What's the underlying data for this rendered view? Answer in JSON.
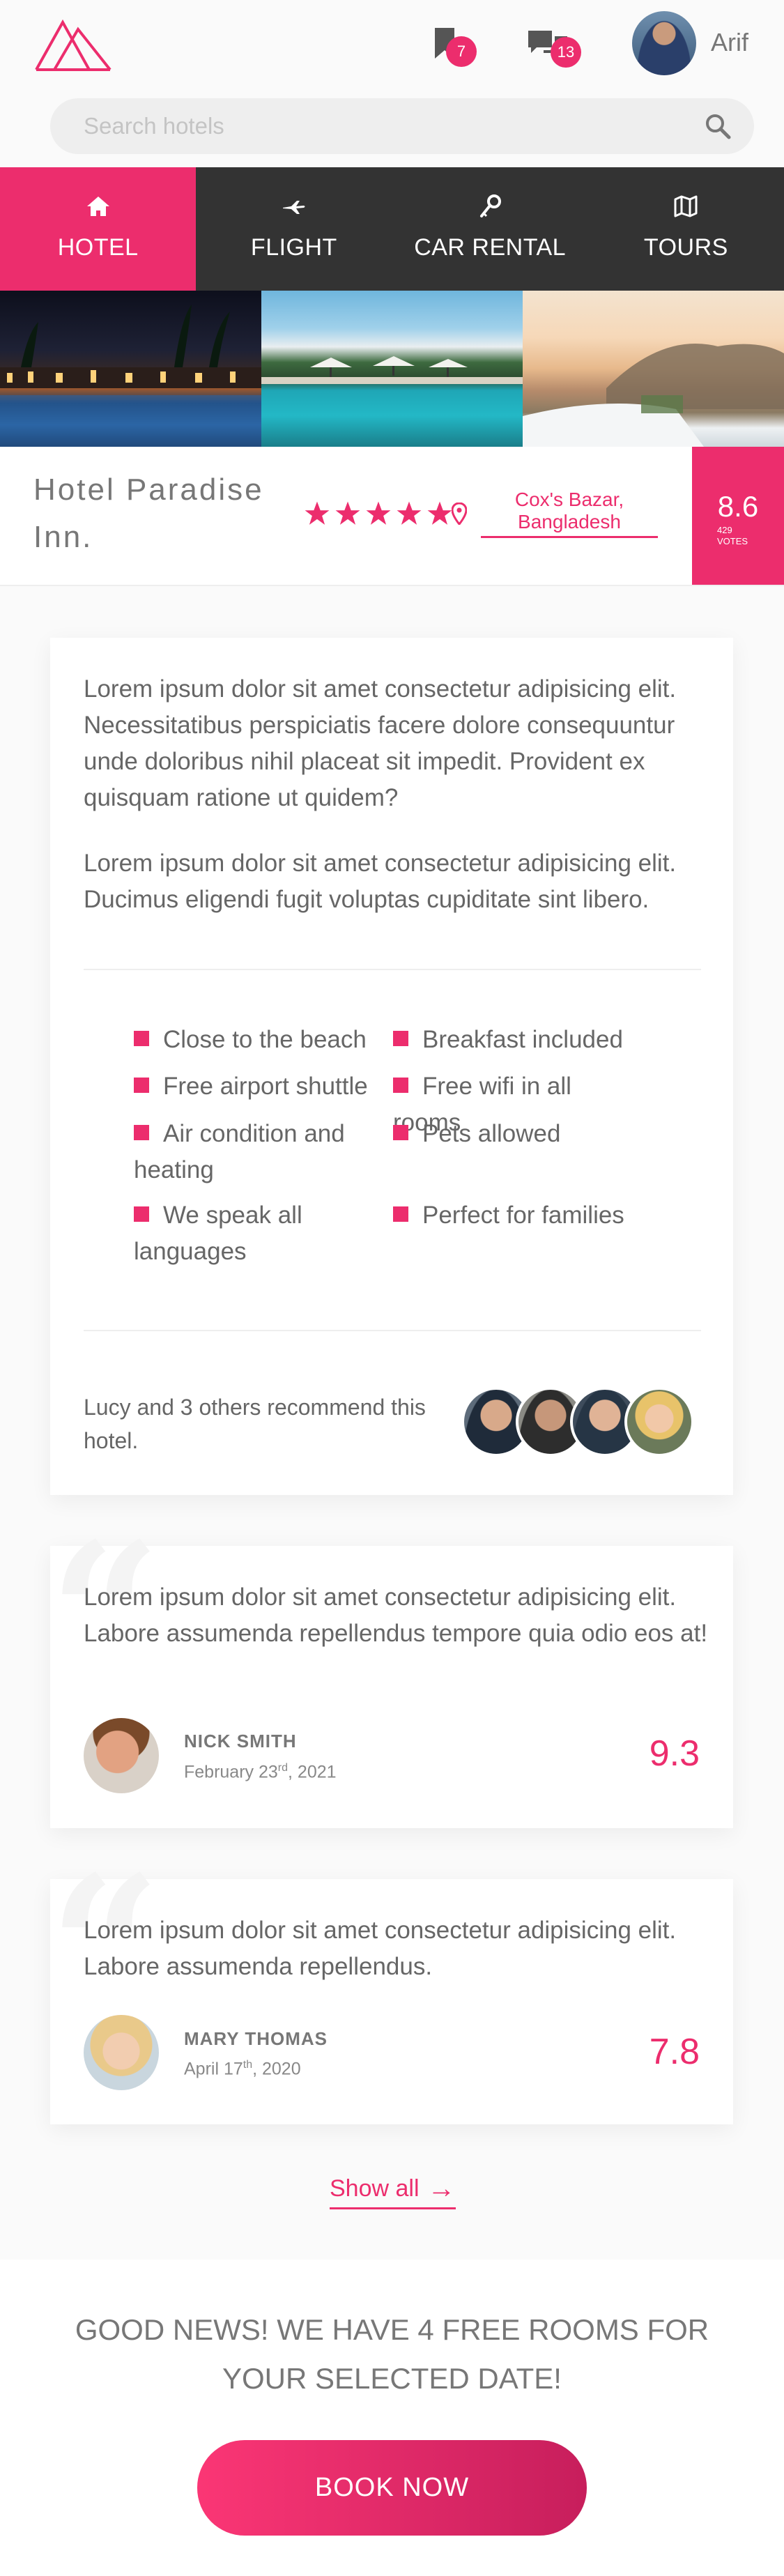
{
  "header": {
    "logo": "mountain-logo",
    "bookmarks_count": "7",
    "messages_count": "13",
    "user_name": "Arif"
  },
  "search": {
    "placeholder": "Search hotels",
    "value": ""
  },
  "nav": {
    "items": [
      {
        "label": "HOTEL",
        "icon": "home-icon",
        "active": true
      },
      {
        "label": "FLIGHT",
        "icon": "plane-icon",
        "active": false
      },
      {
        "label": "CAR RENTAL",
        "icon": "key-icon",
        "active": false
      },
      {
        "label": "TOURS",
        "icon": "map-icon",
        "active": false
      }
    ]
  },
  "hotel": {
    "name": "Hotel Paradise Inn.",
    "stars": 5,
    "location": "Cox's Bazar, Bangladesh",
    "rating": "8.6",
    "votes_count": "429",
    "votes_label": "VOTES"
  },
  "description": {
    "paragraph1": "Lorem ipsum dolor sit amet consectetur adipisicing elit. Necessitatibus perspiciatis facere dolore consequuntur unde doloribus nihil placeat sit impedit. Provident ex quisquam ratione ut quidem?",
    "paragraph2": "Lorem ipsum dolor sit amet consectetur adipisicing elit. Ducimus eligendi fugit voluptas cupiditate sint libero."
  },
  "features": [
    "Close to the beach",
    "Breakfast included",
    "Free airport shuttle",
    "Free wifi in all rooms",
    "Air condition and heating",
    "Pets allowed",
    "We speak all languages",
    "Perfect for families"
  ],
  "recommend": {
    "text": "Lucy and 3 others recommend this hotel."
  },
  "reviews": [
    {
      "text": "Lorem ipsum dolor sit amet consectetur adipisicing elit. Labore assumenda repellendus tempore quia odio eos at!",
      "name": "NICK SMITH",
      "date_prefix": "February 23",
      "date_sup": "rd",
      "date_suffix": ", 2021",
      "score": "9.3"
    },
    {
      "text": "Lorem ipsum dolor sit amet consectetur adipisicing elit. Labore assumenda repellendus.",
      "name": "MARY THOMAS",
      "date_prefix": "April 17",
      "date_sup": "th",
      "date_suffix": ", 2020",
      "score": "7.8"
    }
  ],
  "show_all": {
    "label": "Show all",
    "arrow": "→"
  },
  "cta": {
    "message": "GOOD NEWS! WE HAVE 4 FREE ROOMS FOR YOUR SELECTED DATE!",
    "button": "BOOK NOW"
  },
  "colors": {
    "accent": "#ec2d6d",
    "nav_bg": "#333333",
    "text": "#666666"
  }
}
